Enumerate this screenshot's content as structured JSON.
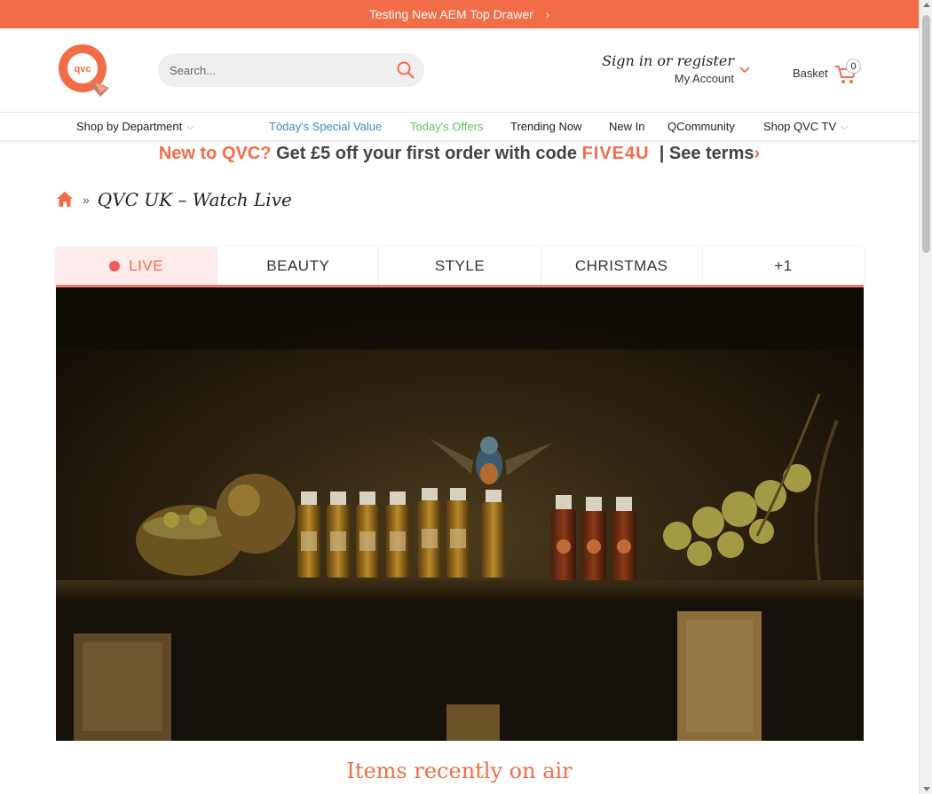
{
  "top_drawer": {
    "text": "Testing New AEM Top Drawer",
    "chevron": "›"
  },
  "brand": {
    "logo_text": "qvc",
    "accent": "#f26d47",
    "special_color": "#3d88c8",
    "offers_color": "#5fc161"
  },
  "search": {
    "placeholder": "Search...",
    "icon": "search-icon"
  },
  "account": {
    "sign_in": "Sign in or register",
    "my_account": "My Account"
  },
  "basket": {
    "label": "Basket",
    "count": "0"
  },
  "nav": {
    "department": "Shop by Department",
    "special_value": "Tōday's Special Value",
    "offers": "Today's Offers",
    "trending": "Trending Now",
    "new_in": "New In",
    "qcommunity": "QCommunity",
    "shop_tv": "Shop QVC TV"
  },
  "promo": {
    "new": "New to QVC?",
    "get": "Get £5 off your first order with code",
    "code": "FIVE4U",
    "terms": "| See terms",
    "terms_chevron": "›"
  },
  "breadcrumb": {
    "separator": "»",
    "title": "QVC UK – Watch Live"
  },
  "tabs": [
    {
      "label": "LIVE",
      "active": true
    },
    {
      "label": "BEAUTY",
      "active": false
    },
    {
      "label": "STYLE",
      "active": false
    },
    {
      "label": "CHRISTMAS",
      "active": false
    },
    {
      "label": "+1",
      "active": false
    }
  ],
  "section": {
    "recent_title": "Items recently on air"
  }
}
